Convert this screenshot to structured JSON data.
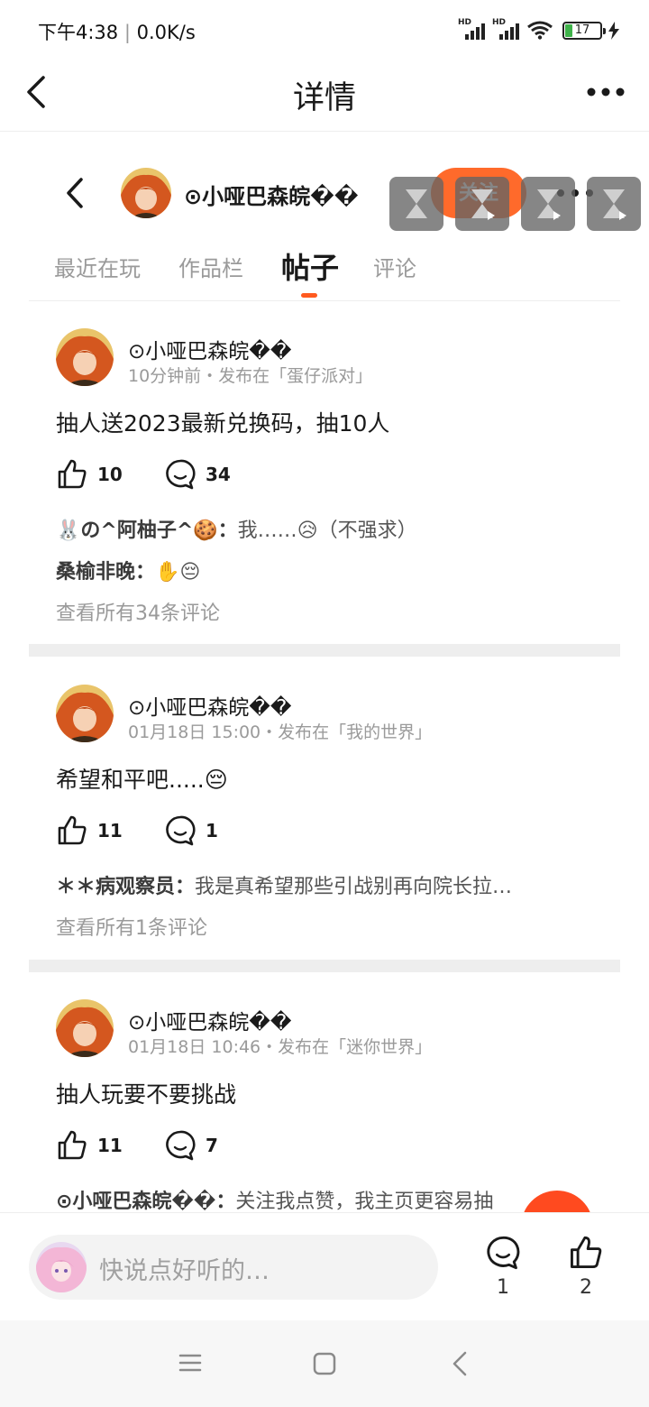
{
  "status_bar": {
    "time": "下午4:38",
    "speed": "0.0K/s",
    "signal_label": "HD",
    "battery": "17"
  },
  "app_bar": {
    "title": "详情"
  },
  "profile": {
    "name": "⊙小哑巴森皖��",
    "follow_label": "关注"
  },
  "tabs": [
    {
      "label": "最近在玩",
      "active": false
    },
    {
      "label": "作品栏",
      "active": false
    },
    {
      "label": "帖子",
      "active": true
    },
    {
      "label": "评论",
      "active": false
    }
  ],
  "posts": [
    {
      "author": "⊙小哑巴森皖��",
      "meta": "10分钟前・发布在「蛋仔派对」",
      "text": "抽人送2023最新兑换码，抽10人",
      "likes": "10",
      "comments": "34",
      "comment_previews": [
        {
          "user": "🐰の^阿柚子^🍪：",
          "text": "我……😥（不强求）"
        },
        {
          "user": "桑榆非晚：",
          "text": "✋😔"
        }
      ],
      "view_all": "查看所有34条评论"
    },
    {
      "author": "⊙小哑巴森皖��",
      "meta": "01月18日 15:00・发布在「我的世界」",
      "text": "希望和平吧.....😔",
      "likes": "11",
      "comments": "1",
      "comment_previews": [
        {
          "user": "＊＊病观察员：",
          "text": "我是真希望那些引战别再向院长拉…"
        }
      ],
      "view_all": "查看所有1条评论"
    },
    {
      "author": "⊙小哑巴森皖��",
      "meta": "01月18日 10:46・发布在「迷你世界」",
      "text": "抽人玩要不要挑战",
      "likes": "11",
      "comments": "7",
      "comment_previews": [
        {
          "user": "⊙小哑巴森皖��：",
          "text": "关注我点赞，我主页更容易抽"
        }
      ]
    }
  ],
  "bottom_bar": {
    "placeholder": "快说点好听的…",
    "comment_count": "1",
    "like_count": "2"
  },
  "colors": {
    "accent": "#ff6a2b",
    "tab_indicator": "#ff5a1f",
    "muted_text": "#9a9a9a",
    "divider": "#eeeeee"
  },
  "icons": [
    "back-icon",
    "more-icon",
    "like-icon",
    "comment-icon",
    "nav-menu-icon",
    "nav-home-icon",
    "nav-back-icon"
  ]
}
